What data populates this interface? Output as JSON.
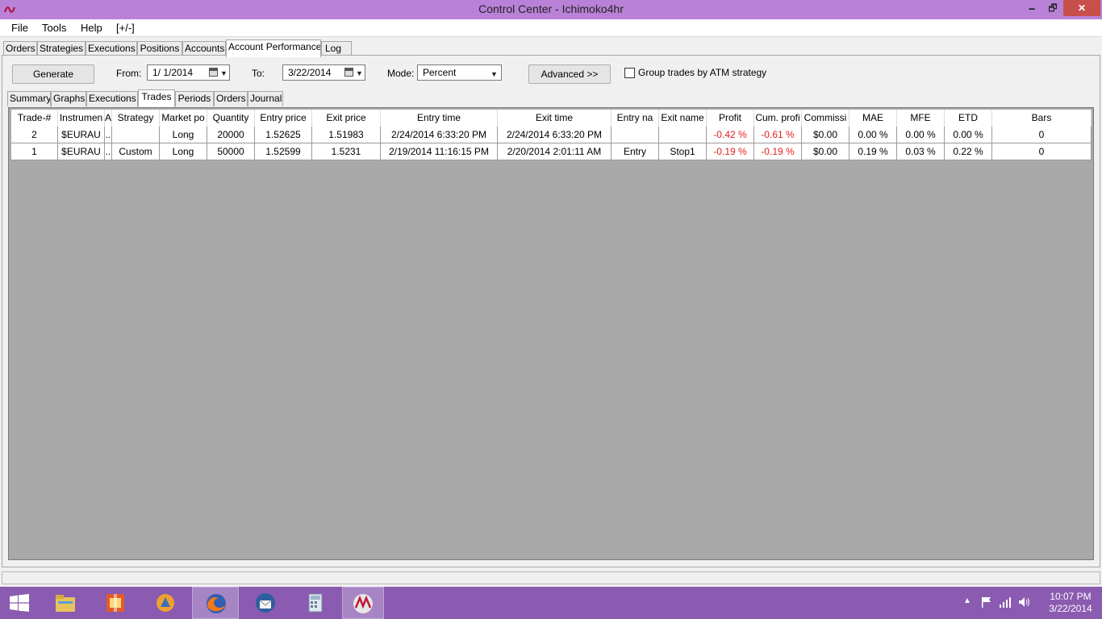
{
  "window": {
    "title": "Control Center - Ichimoko4hr",
    "minimize": "🗕",
    "maximize": "🗗",
    "close": "✕"
  },
  "menu": {
    "items": [
      "File",
      "Tools",
      "Help",
      "[+/-]"
    ]
  },
  "main_tabs": [
    "Orders",
    "Strategies",
    "Executions",
    "Positions",
    "Accounts",
    "Account Performance",
    "Log"
  ],
  "main_tab_active": "Account Performance",
  "toolbar": {
    "generate": "Generate",
    "from_label": "From:",
    "from_value": "1/  1/2014",
    "to_label": "To:",
    "to_value": "3/22/2014",
    "mode_label": "Mode:",
    "mode_value": "Percent",
    "advanced": "Advanced >>",
    "group_label": "Group trades by ATM strategy"
  },
  "sub_tabs": [
    "Summary",
    "Graphs",
    "Executions",
    "Trades",
    "Periods",
    "Orders",
    "Journal"
  ],
  "sub_tab_active": "Trades",
  "table": {
    "headers": [
      "Trade-#",
      "Instrumen",
      "A",
      "Strategy",
      "Market po",
      "Quantity",
      "Entry price",
      "Exit price",
      "Entry time",
      "Exit time",
      "Entry na",
      "Exit name",
      "Profit",
      "Cum. profi",
      "Commissi",
      "MAE",
      "MFE",
      "ETD",
      "Bars"
    ],
    "rows": [
      [
        "2",
        "$EURAU",
        "..",
        "",
        "Long",
        "20000",
        "1.52625",
        "1.51983",
        "2/24/2014 6:33:20 PM",
        "2/24/2014 6:33:20 PM",
        "",
        "",
        "-0.42 %",
        "-0.61 %",
        "$0.00",
        "0.00 %",
        "0.00 %",
        "0.00 %",
        "0"
      ],
      [
        "1",
        "$EURAU",
        "..",
        "Custom",
        "Long",
        "50000",
        "1.52599",
        "1.5231",
        "2/19/2014 11:16:15 PM",
        "2/20/2014 2:01:11 AM",
        "Entry",
        "Stop1",
        "-0.19 %",
        "-0.19 %",
        "$0.00",
        "0.19 %",
        "0.03 %",
        "0.22 %",
        "0"
      ]
    ]
  },
  "taskbar": {
    "clock_time": "10:07 PM",
    "clock_date": "3/22/2014"
  },
  "colors": {
    "titlebar": "#b982d8",
    "taskbar": "#8a5bb0",
    "negative": "#e02020"
  }
}
